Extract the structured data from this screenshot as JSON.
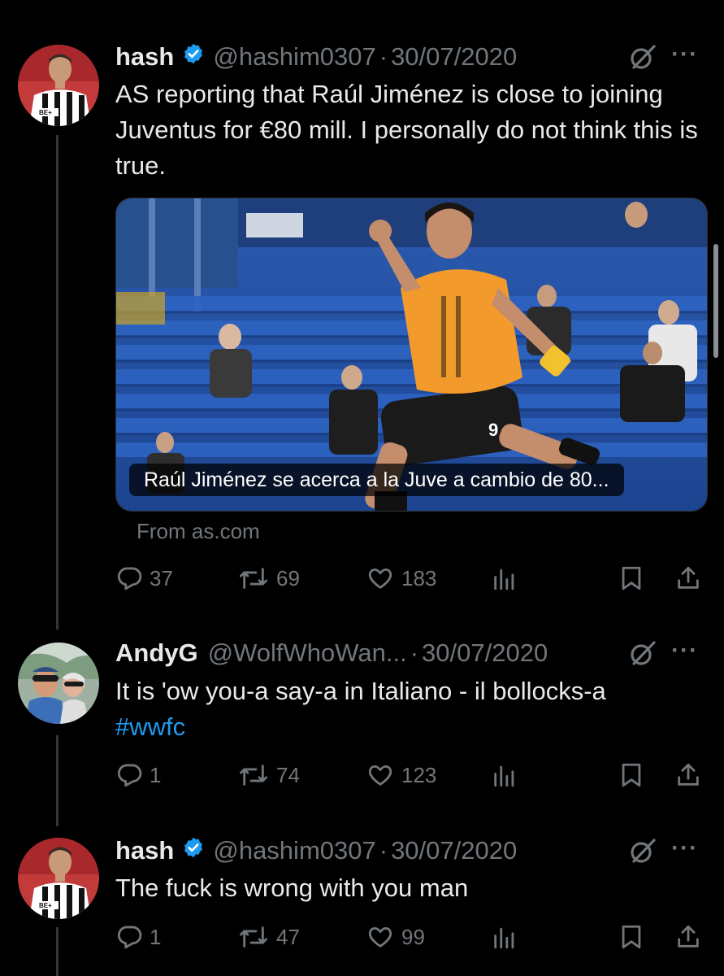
{
  "tweets": [
    {
      "name": "hash",
      "handle": "@hashim0307",
      "separator": "·",
      "date": "30/07/2020",
      "text": "AS reporting that Raúl Jiménez is close to joining Juventus for €80 mill. I personally do not think this is true.",
      "card": {
        "caption": "Raúl Jiménez se acerca a la Juve a cambio de 80...",
        "source": "From as.com"
      },
      "counts": {
        "replies": "37",
        "reposts": "69",
        "likes": "183"
      }
    },
    {
      "name": "AndyG",
      "handle": "@WolfWhoWan...",
      "separator": "·",
      "date": "30/07/2020",
      "text": "It is 'ow you-a say-a in Italiano - il bollocks-a",
      "hashtag": "#wwfc",
      "counts": {
        "replies": "1",
        "reposts": "74",
        "likes": "123"
      }
    },
    {
      "name": "hash",
      "handle": "@hashim0307",
      "separator": "·",
      "date": "30/07/2020",
      "text": "The fuck is wrong with you man",
      "counts": {
        "replies": "1",
        "reposts": "47",
        "likes": "99"
      }
    }
  ],
  "more_glyph": "···",
  "icons": {
    "verified": "verified-badge-icon",
    "grok": "grok-icon",
    "reply": "reply-icon",
    "repost": "repost-icon",
    "like": "heart-icon",
    "views": "views-icon",
    "bookmark": "bookmark-icon",
    "share": "share-icon"
  },
  "colors": {
    "background": "#000000",
    "text": "#e7e9ea",
    "secondary": "#71767b",
    "link": "#1d9bf0",
    "verified": "#1d9bf0"
  }
}
